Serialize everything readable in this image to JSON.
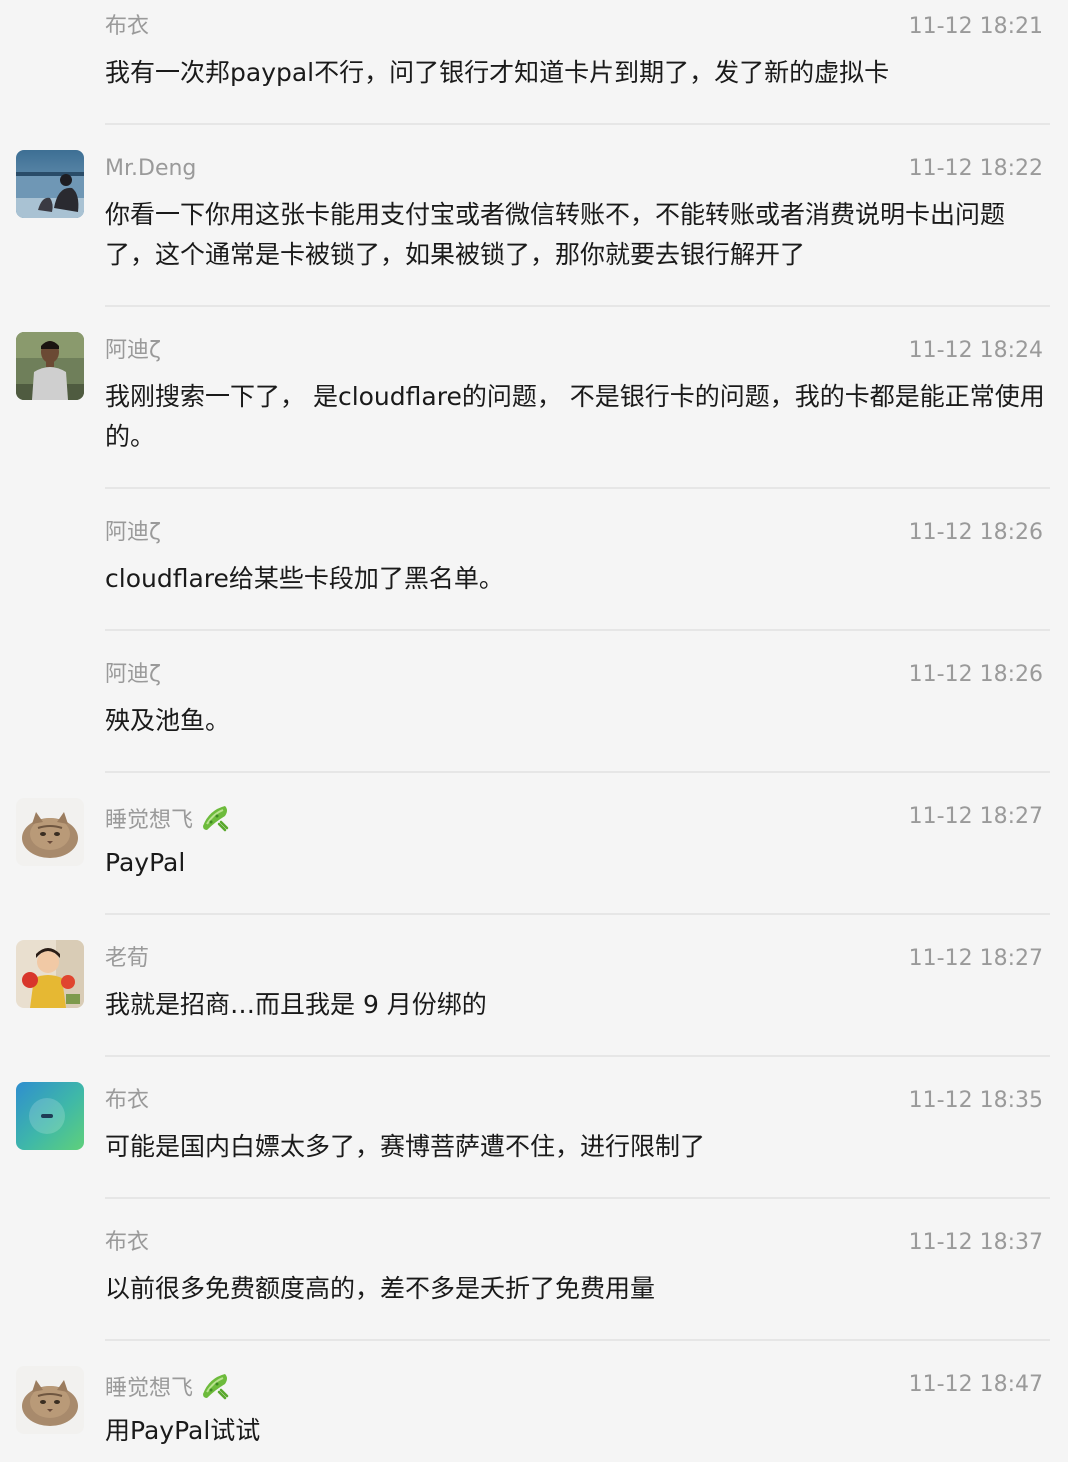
{
  "messages": [
    {
      "sender": "布衣",
      "time": "11-12 18:21",
      "text": "我有一次邦paypal不行，问了银行才知道卡片到期了，发了新的虚拟卡",
      "avatar": null,
      "badge": false
    },
    {
      "sender": "Mr.Deng",
      "time": "11-12 18:22",
      "text": "你看一下你用这张卡能用支付宝或者微信转账不，不能转账或者消费说明卡出问题了，这个通常是卡被锁了，如果被锁了，那你就要去银行解开了",
      "avatar": "lake-photo",
      "badge": false
    },
    {
      "sender": "阿迪ζ",
      "time": "11-12 18:24",
      "text": "我刚搜索一下了， 是cloudflare的问题， 不是银行卡的问题，我的卡都是能正常使用的。",
      "avatar": "person-photo",
      "badge": false
    },
    {
      "sender": "阿迪ζ",
      "time": "11-12 18:26",
      "text": "cloudflare给某些卡段加了黑名单。",
      "avatar": null,
      "badge": false
    },
    {
      "sender": "阿迪ζ",
      "time": "11-12 18:26",
      "text": "殃及池鱼。",
      "avatar": null,
      "badge": false
    },
    {
      "sender": "睡觉想飞",
      "time": "11-12 18:27",
      "text": "PayPal",
      "avatar": "cat-photo",
      "badge": true
    },
    {
      "sender": "老荀",
      "time": "11-12 18:27",
      "text": "我就是招商…而且我是 9 月份绑的",
      "avatar": "child-photo",
      "badge": false
    },
    {
      "sender": "布衣",
      "time": "11-12 18:35",
      "text": "可能是国内白嫖太多了，赛博菩萨遭不住，进行限制了",
      "avatar": "gradient-avatar",
      "badge": false
    },
    {
      "sender": "布衣",
      "time": "11-12 18:37",
      "text": "以前很多免费额度高的，差不多是夭折了免费用量",
      "avatar": null,
      "badge": false
    },
    {
      "sender": "睡觉想飞",
      "time": "11-12 18:47",
      "text": "用PayPal试试",
      "avatar": "cat-photo",
      "badge": true
    }
  ],
  "colors": {
    "background": "#f5f5f5",
    "meta_text": "#9a9a9a",
    "body_text": "#1a1a1a",
    "divider": "#e6e6e6"
  }
}
